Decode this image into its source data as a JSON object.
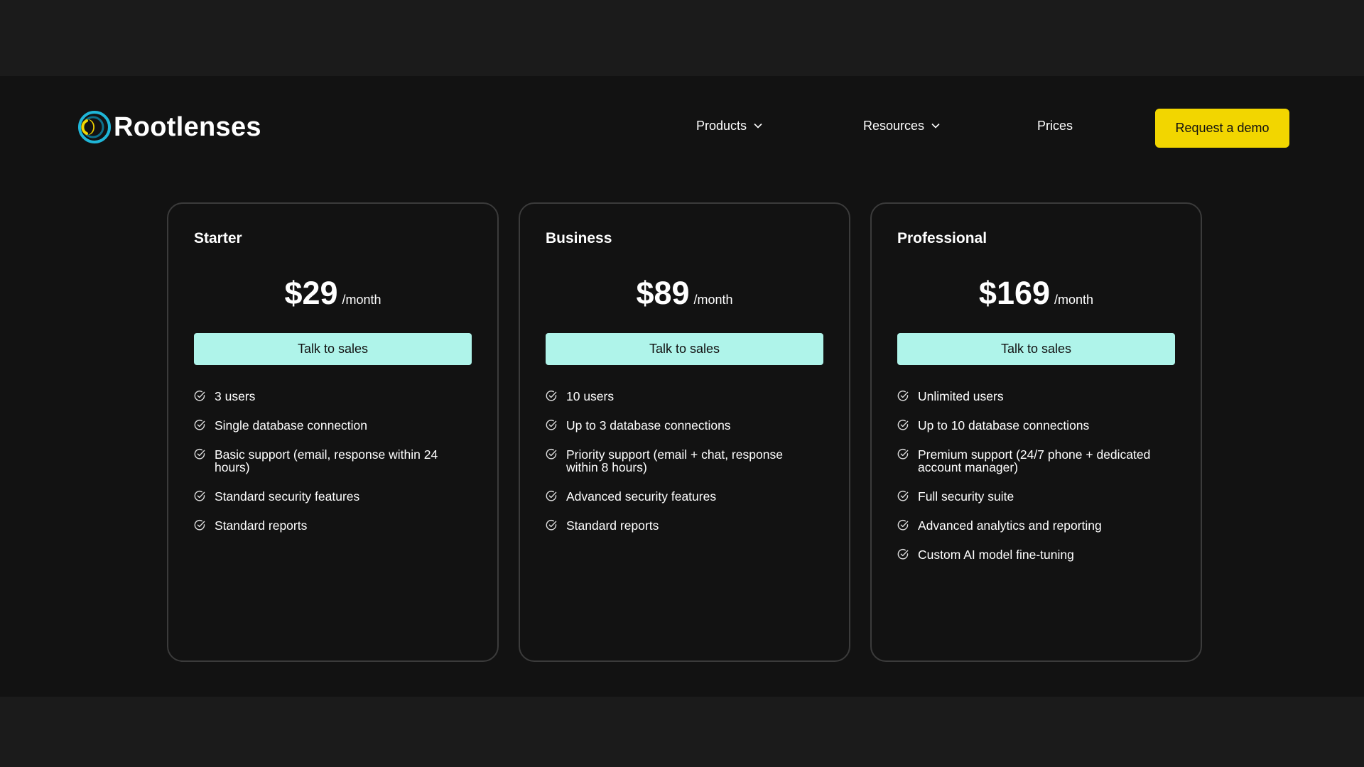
{
  "brand": {
    "name": "Rootlenses",
    "logo_icon": "rootlenses-logo-icon"
  },
  "nav": {
    "items": [
      {
        "label": "Products",
        "has_dropdown": true
      },
      {
        "label": "Resources",
        "has_dropdown": true
      },
      {
        "label": "Prices",
        "has_dropdown": false
      }
    ],
    "cta_label": "Request a demo"
  },
  "colors": {
    "page_background": "#121212",
    "outer_background": "#1b1b1b",
    "card_border": "#3b3b3b",
    "cta_yellow": "#f2d600",
    "sales_button": "#aff4ea",
    "text": "#ffffff"
  },
  "plans": [
    {
      "name": "Starter",
      "price": "$29",
      "period": "/month",
      "button_label": "Talk to sales",
      "features": [
        "3 users",
        "Single database connection",
        "Basic support (email, response within 24 hours)",
        "Standard security features",
        "Standard reports"
      ]
    },
    {
      "name": "Business",
      "price": "$89",
      "period": "/month",
      "button_label": "Talk to sales",
      "features": [
        "10 users",
        "Up to 3 database connections",
        "Priority support (email + chat, response within 8 hours)",
        "Advanced security features",
        "Standard reports"
      ]
    },
    {
      "name": "Professional",
      "price": "$169",
      "period": "/month",
      "button_label": "Talk to sales",
      "features": [
        "Unlimited users",
        "Up to 10 database connections",
        "Premium support (24/7 phone + dedicated account manager)",
        "Full security suite",
        "Advanced analytics and reporting",
        "Custom AI model fine-tuning"
      ]
    }
  ]
}
